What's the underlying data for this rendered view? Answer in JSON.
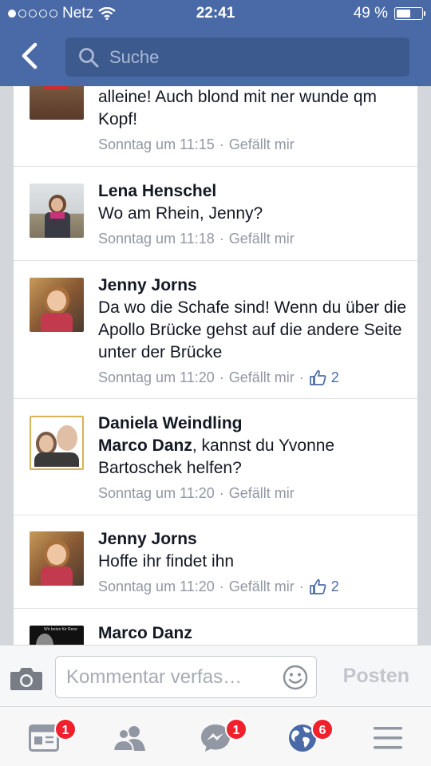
{
  "status_bar": {
    "carrier": "Netz",
    "time": "22:41",
    "battery_text": "49 %",
    "battery_level": 0.49
  },
  "search": {
    "placeholder": "Suche"
  },
  "comments": [
    {
      "name": "",
      "text": "alleine! Auch blond mit ner wunde qm Kopf!",
      "time": "Sonntag um 11:15",
      "like_label": "Gefällt mir",
      "likes": ""
    },
    {
      "name": "Lena Henschel",
      "text": "Wo am Rhein, Jenny?",
      "time": "Sonntag um 11:18",
      "like_label": "Gefällt mir",
      "likes": ""
    },
    {
      "name": "Jenny Jorns",
      "text": "Da wo die Schafe sind! Wenn du über die Apollo Brücke gehst auf die andere Seite unter der Brücke",
      "time": "Sonntag um 11:20",
      "like_label": "Gefällt mir",
      "likes": "2"
    },
    {
      "name": "Daniela Weindling",
      "mention": "Marco Danz",
      "text": ", kannst du Yvonne Bartoschek helfen?",
      "time": "Sonntag um 11:20",
      "like_label": "Gefällt mir",
      "likes": ""
    },
    {
      "name": "Jenny Jorns",
      "text": "Hoffe ihr findet ihn",
      "time": "Sonntag um 11:20",
      "like_label": "Gefällt mir",
      "likes": "2"
    },
    {
      "name": "Marco Danz",
      "avatar_caption": "Wir beten für Rene"
    }
  ],
  "meta_separator": "·",
  "composer": {
    "placeholder": "Kommentar verfas…",
    "post_label": "Posten"
  },
  "tabbar": {
    "feed_badge": "1",
    "messages_badge": "1",
    "notifications_badge": "6"
  },
  "colors": {
    "brand": "#4a6aa7",
    "badge": "#f0202d",
    "meta": "#9197a3"
  }
}
